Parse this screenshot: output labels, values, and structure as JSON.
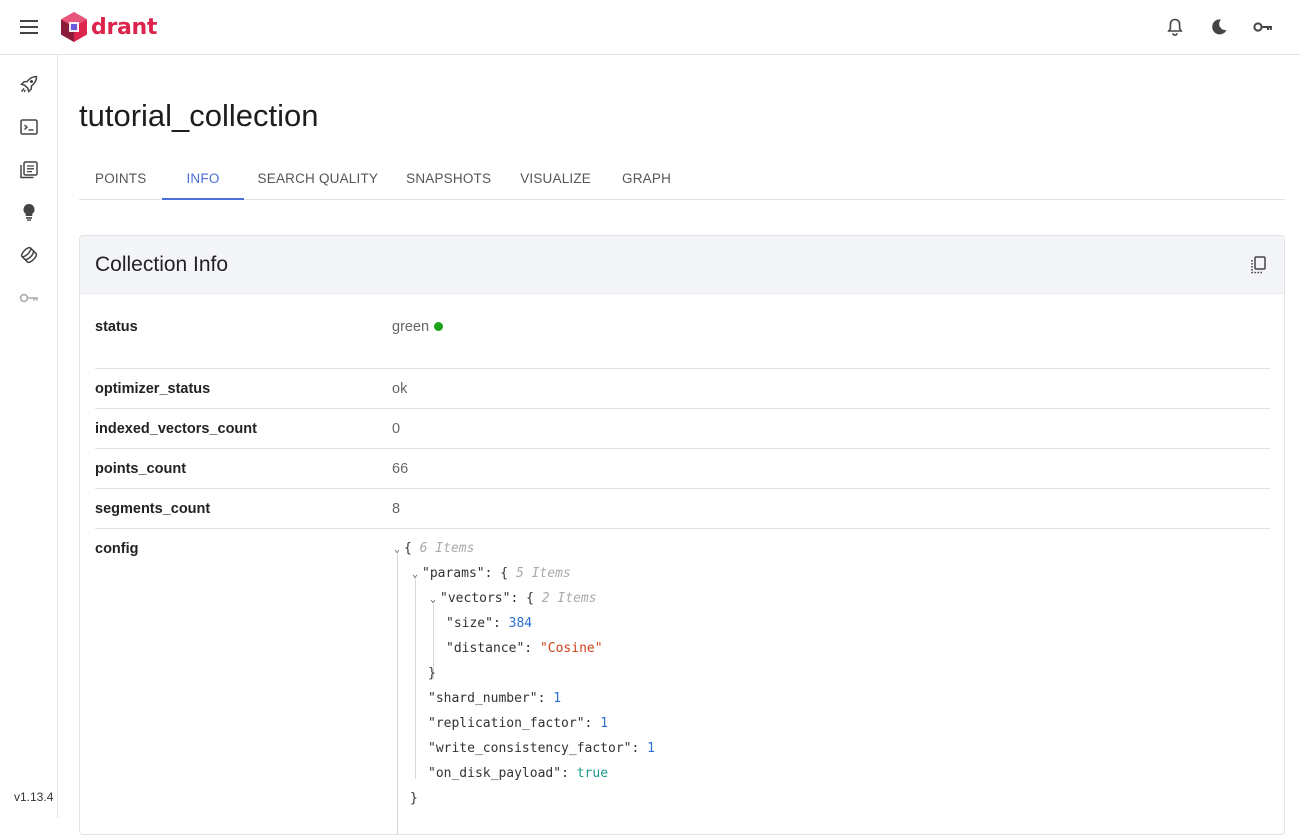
{
  "app": {
    "logo_text": "drant",
    "brand_color": "#dc244c",
    "accent_color": "#4a6fd8",
    "version": "v1.13.4"
  },
  "topbar": {
    "icons": [
      "menu-icon",
      "bell-icon",
      "moon-icon",
      "key-icon"
    ]
  },
  "sidebar": {
    "items": [
      "rocket-icon",
      "terminal-icon",
      "collections-icon",
      "lightbulb-icon",
      "datasets-icon",
      "key-icon"
    ]
  },
  "page": {
    "title": "tutorial_collection",
    "tabs": [
      {
        "label": "POINTS",
        "active": false
      },
      {
        "label": "INFO",
        "active": true
      },
      {
        "label": "SEARCH QUALITY",
        "active": false
      },
      {
        "label": "SNAPSHOTS",
        "active": false
      },
      {
        "label": "VISUALIZE",
        "active": false
      },
      {
        "label": "GRAPH",
        "active": false
      }
    ]
  },
  "card": {
    "title": "Collection Info",
    "rows": [
      {
        "key": "status",
        "value": "green",
        "status_color": "#1aa31a"
      },
      {
        "key": "optimizer_status",
        "value": "ok"
      },
      {
        "key": "indexed_vectors_count",
        "value": "0"
      },
      {
        "key": "points_count",
        "value": "66"
      },
      {
        "key": "segments_count",
        "value": "8"
      },
      {
        "key": "config",
        "value": ""
      }
    ],
    "config_json": {
      "root_meta": "6 Items",
      "params_key": "\"params\"",
      "params_meta": "5 Items",
      "vectors_key": "\"vectors\"",
      "vectors_meta": "2 Items",
      "size_key": "\"size\"",
      "size_val": "384",
      "distance_key": "\"distance\"",
      "distance_val": "\"Cosine\"",
      "shard_number_key": "\"shard_number\"",
      "shard_number_val": "1",
      "replication_factor_key": "\"replication_factor\"",
      "replication_factor_val": "1",
      "write_consistency_factor_key": "\"write_consistency_factor\"",
      "write_consistency_factor_val": "1",
      "on_disk_payload_key": "\"on_disk_payload\"",
      "on_disk_payload_val": "true"
    }
  }
}
